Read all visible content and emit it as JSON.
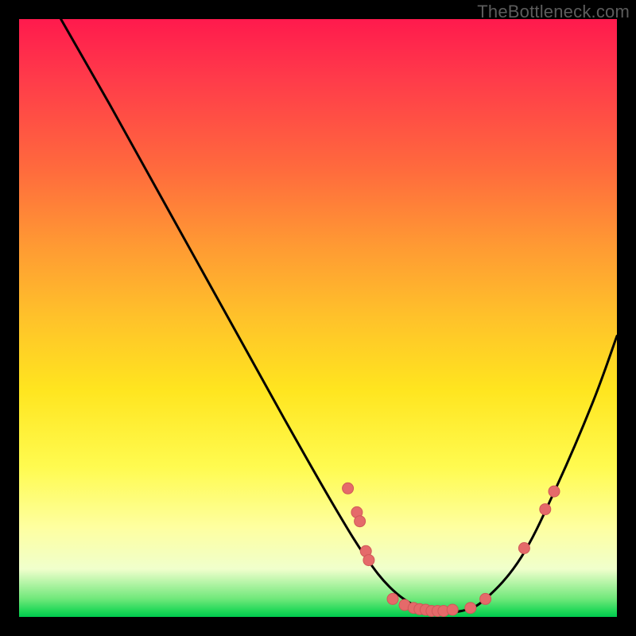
{
  "watermark": "TheBottleneck.com",
  "colors": {
    "background": "#000000",
    "curve": "#000000",
    "marker_fill": "#e56a6a",
    "marker_stroke": "#d05858"
  },
  "chart_data": {
    "type": "line",
    "title": "",
    "xlabel": "",
    "ylabel": "",
    "xlim": [
      0,
      100
    ],
    "ylim": [
      0,
      100
    ],
    "grid": false,
    "legend": false,
    "series": [
      {
        "name": "bottleneck-curve",
        "x": [
          7,
          15,
          25,
          35,
          45,
          53,
          58,
          62,
          66,
          70,
          74,
          78,
          84,
          90,
          96,
          100
        ],
        "y": [
          100,
          86,
          68,
          50,
          32,
          18,
          10,
          5,
          2,
          1,
          1,
          3,
          10,
          22,
          36,
          47
        ]
      }
    ],
    "markers": [
      {
        "x": 55.0,
        "y": 21.5
      },
      {
        "x": 56.5,
        "y": 17.5
      },
      {
        "x": 57.0,
        "y": 16.0
      },
      {
        "x": 58.0,
        "y": 11.0
      },
      {
        "x": 58.5,
        "y": 9.5
      },
      {
        "x": 62.5,
        "y": 3.0
      },
      {
        "x": 64.5,
        "y": 2.0
      },
      {
        "x": 66.0,
        "y": 1.5
      },
      {
        "x": 67.0,
        "y": 1.3
      },
      {
        "x": 68.0,
        "y": 1.2
      },
      {
        "x": 69.0,
        "y": 1.0
      },
      {
        "x": 70.0,
        "y": 1.0
      },
      {
        "x": 71.0,
        "y": 1.0
      },
      {
        "x": 72.5,
        "y": 1.2
      },
      {
        "x": 75.5,
        "y": 1.5
      },
      {
        "x": 78.0,
        "y": 3.0
      },
      {
        "x": 84.5,
        "y": 11.5
      },
      {
        "x": 88.0,
        "y": 18.0
      },
      {
        "x": 89.5,
        "y": 21.0
      }
    ]
  }
}
